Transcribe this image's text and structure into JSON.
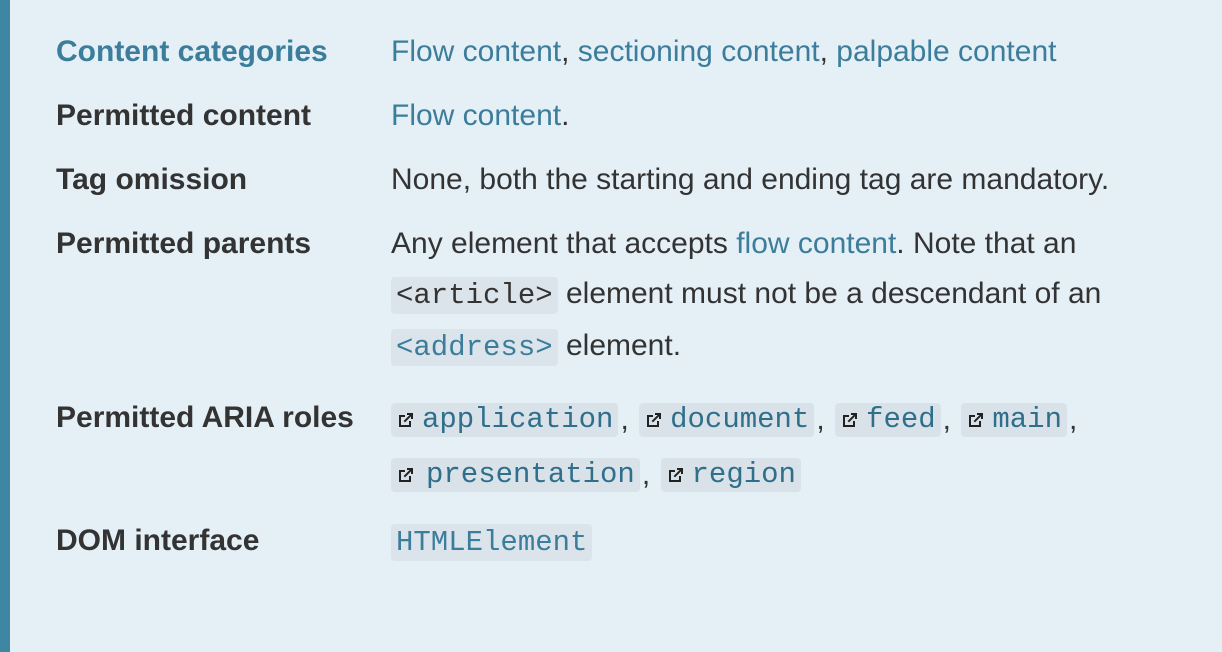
{
  "properties": {
    "content_categories": {
      "label": "Content categories",
      "links": [
        "Flow content",
        "sectioning content",
        "palpable content"
      ],
      "sep": ", "
    },
    "permitted_content": {
      "label": "Permitted content",
      "link": "Flow content",
      "suffix": "."
    },
    "tag_omission": {
      "label": "Tag omission",
      "text": "None, both the starting and ending tag are mandatory."
    },
    "permitted_parents": {
      "label": "Permitted parents",
      "text_before": "Any element that accepts ",
      "link": "flow content",
      "text_after": ". Note that an",
      "code_article": "<article>",
      "text_mid": " element must not be a descendant of an",
      "code_address": "<address>",
      "text_end": " element."
    },
    "permitted_aria_roles": {
      "label": "Permitted ARIA roles",
      "roles": [
        "application",
        "document",
        "feed",
        "main",
        "presentation",
        "region"
      ],
      "sep": ","
    },
    "dom_interface": {
      "label": "DOM interface",
      "value": "HTMLElement"
    }
  },
  "icons": {
    "external_link": "external-link-icon"
  },
  "colors": {
    "accent": "#3b7d9a",
    "sidebar": "#3e87a3",
    "background": "#e4eff6"
  }
}
